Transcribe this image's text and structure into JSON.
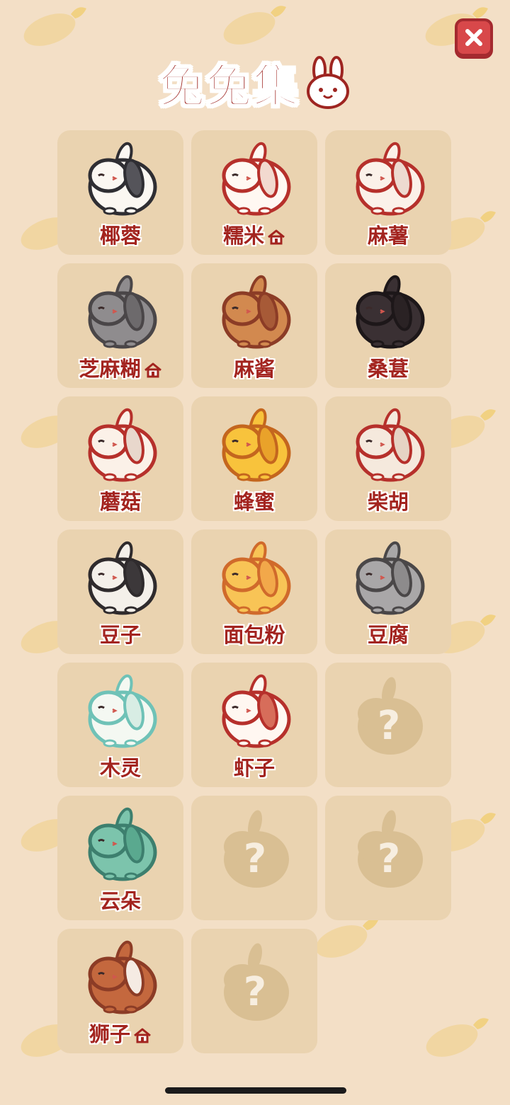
{
  "header": {
    "title": "兔兔集"
  },
  "close_button": {
    "icon": "close-icon"
  },
  "bunnies": [
    {
      "name": "椰蓉",
      "fur": "#fbf7f2",
      "patch": "#55545a",
      "outline": "#2f2e33",
      "home": false
    },
    {
      "name": "糯米",
      "fur": "#fff8f2",
      "patch": "#f2d9cf",
      "outline": "#b6302b",
      "home": true
    },
    {
      "name": "麻薯",
      "fur": "#fbf1e9",
      "patch": "#eddad0",
      "outline": "#b6302b",
      "home": false
    },
    {
      "name": "芝麻糊",
      "fur": "#8f8c8e",
      "patch": "#6d6a6c",
      "outline": "#4a4648",
      "home": true
    },
    {
      "name": "麻酱",
      "fur": "#d2894f",
      "patch": "#a75a37",
      "outline": "#8c3c26",
      "home": false
    },
    {
      "name": "桑葚",
      "fur": "#3a3033",
      "patch": "#2a2224",
      "outline": "#1d1719",
      "home": false
    },
    {
      "name": "蘑菇",
      "fur": "#fbf1e8",
      "patch": "#e8d7cc",
      "outline": "#b6302b",
      "home": false
    },
    {
      "name": "蜂蜜",
      "fur": "#f8c33c",
      "patch": "#e9a22a",
      "outline": "#c4661e",
      "home": false
    },
    {
      "name": "柴胡",
      "fur": "#f5e9dd",
      "patch": "#e6d3c4",
      "outline": "#b6302b",
      "home": false
    },
    {
      "name": "豆子",
      "fur": "#f4f0ea",
      "patch": "#3c383a",
      "outline": "#2f2b2d",
      "home": false
    },
    {
      "name": "面包粉",
      "fur": "#f8c456",
      "patch": "#f2a84a",
      "outline": "#d06a2b",
      "home": false
    },
    {
      "name": "豆腐",
      "fur": "#a9a7a8",
      "patch": "#8d8b8c",
      "outline": "#4a4748",
      "home": false
    },
    {
      "name": "木灵",
      "fur": "#f4f8f2",
      "patch": "#d8ede4",
      "outline": "#6fc2b7",
      "home": false
    },
    {
      "name": "虾子",
      "fur": "#fff7f1",
      "patch": "#d76d5a",
      "outline": "#b6302b",
      "home": false
    },
    {
      "name": "",
      "locked": true
    },
    {
      "name": "云朵",
      "fur": "#7cc4ac",
      "patch": "#5aa98f",
      "outline": "#3d7f6e",
      "home": false
    },
    {
      "name": "",
      "locked": true
    },
    {
      "name": "",
      "locked": true
    },
    {
      "name": "狮子",
      "fur": "#c4683e",
      "patch": "#f5ebe3",
      "outline": "#8c3c26",
      "home": true
    },
    {
      "name": "",
      "locked": true
    }
  ],
  "locked_mark": "?"
}
